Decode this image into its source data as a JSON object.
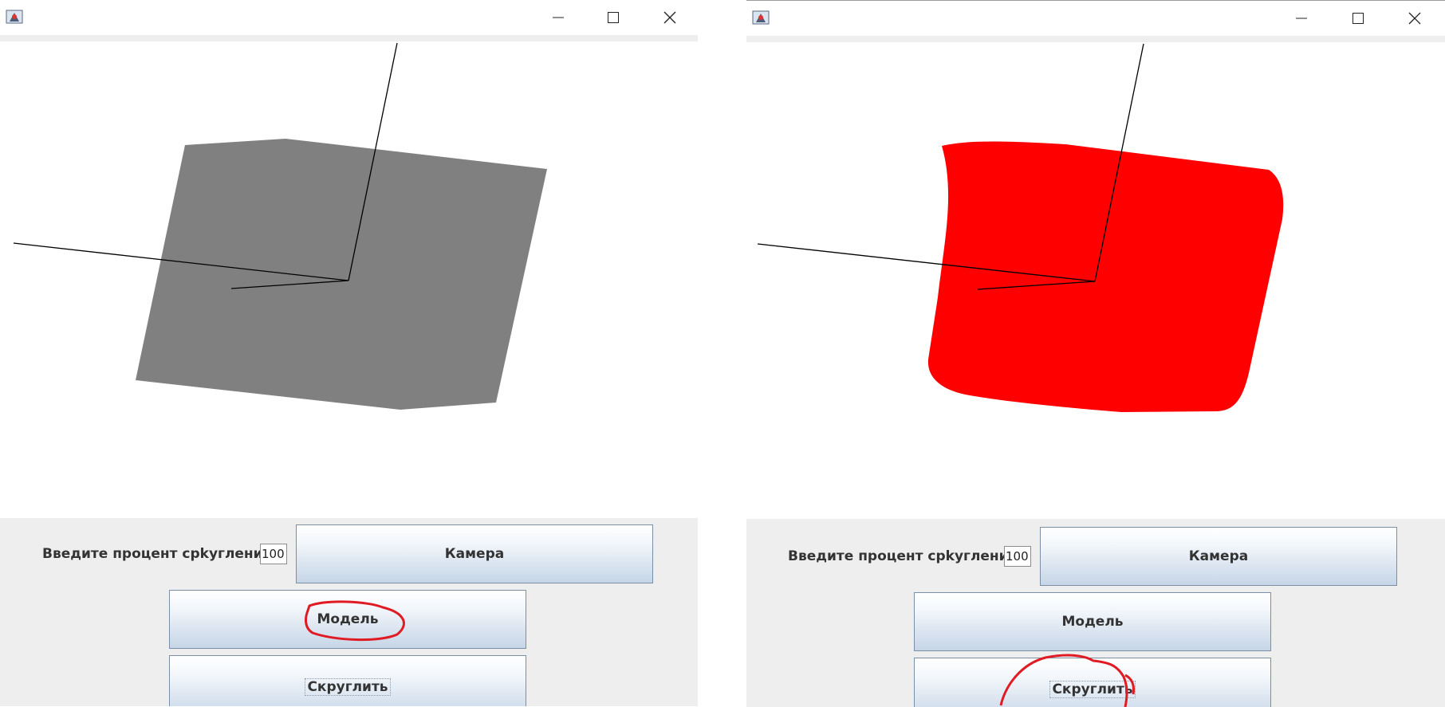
{
  "left_window": {
    "controls": {
      "minimize": "minimize-icon",
      "maximize": "maximize-icon",
      "close": "close-icon"
    },
    "rounding_label": "Введите процент срkyгления",
    "rounding_value": "100",
    "camera_button": "Камера",
    "model_button": "Модель",
    "round_button": "Скруглить",
    "shape_color": "#808080"
  },
  "right_window": {
    "controls": {
      "minimize": "minimize-icon",
      "maximize": "maximize-icon",
      "close": "close-icon"
    },
    "rounding_label": "Введите процент срkyгления",
    "rounding_value": "100",
    "camera_button": "Камера",
    "model_button": "Модель",
    "round_button": "Скруглить",
    "shape_color": "#ff0000"
  },
  "annotation_color": "#e01b24"
}
